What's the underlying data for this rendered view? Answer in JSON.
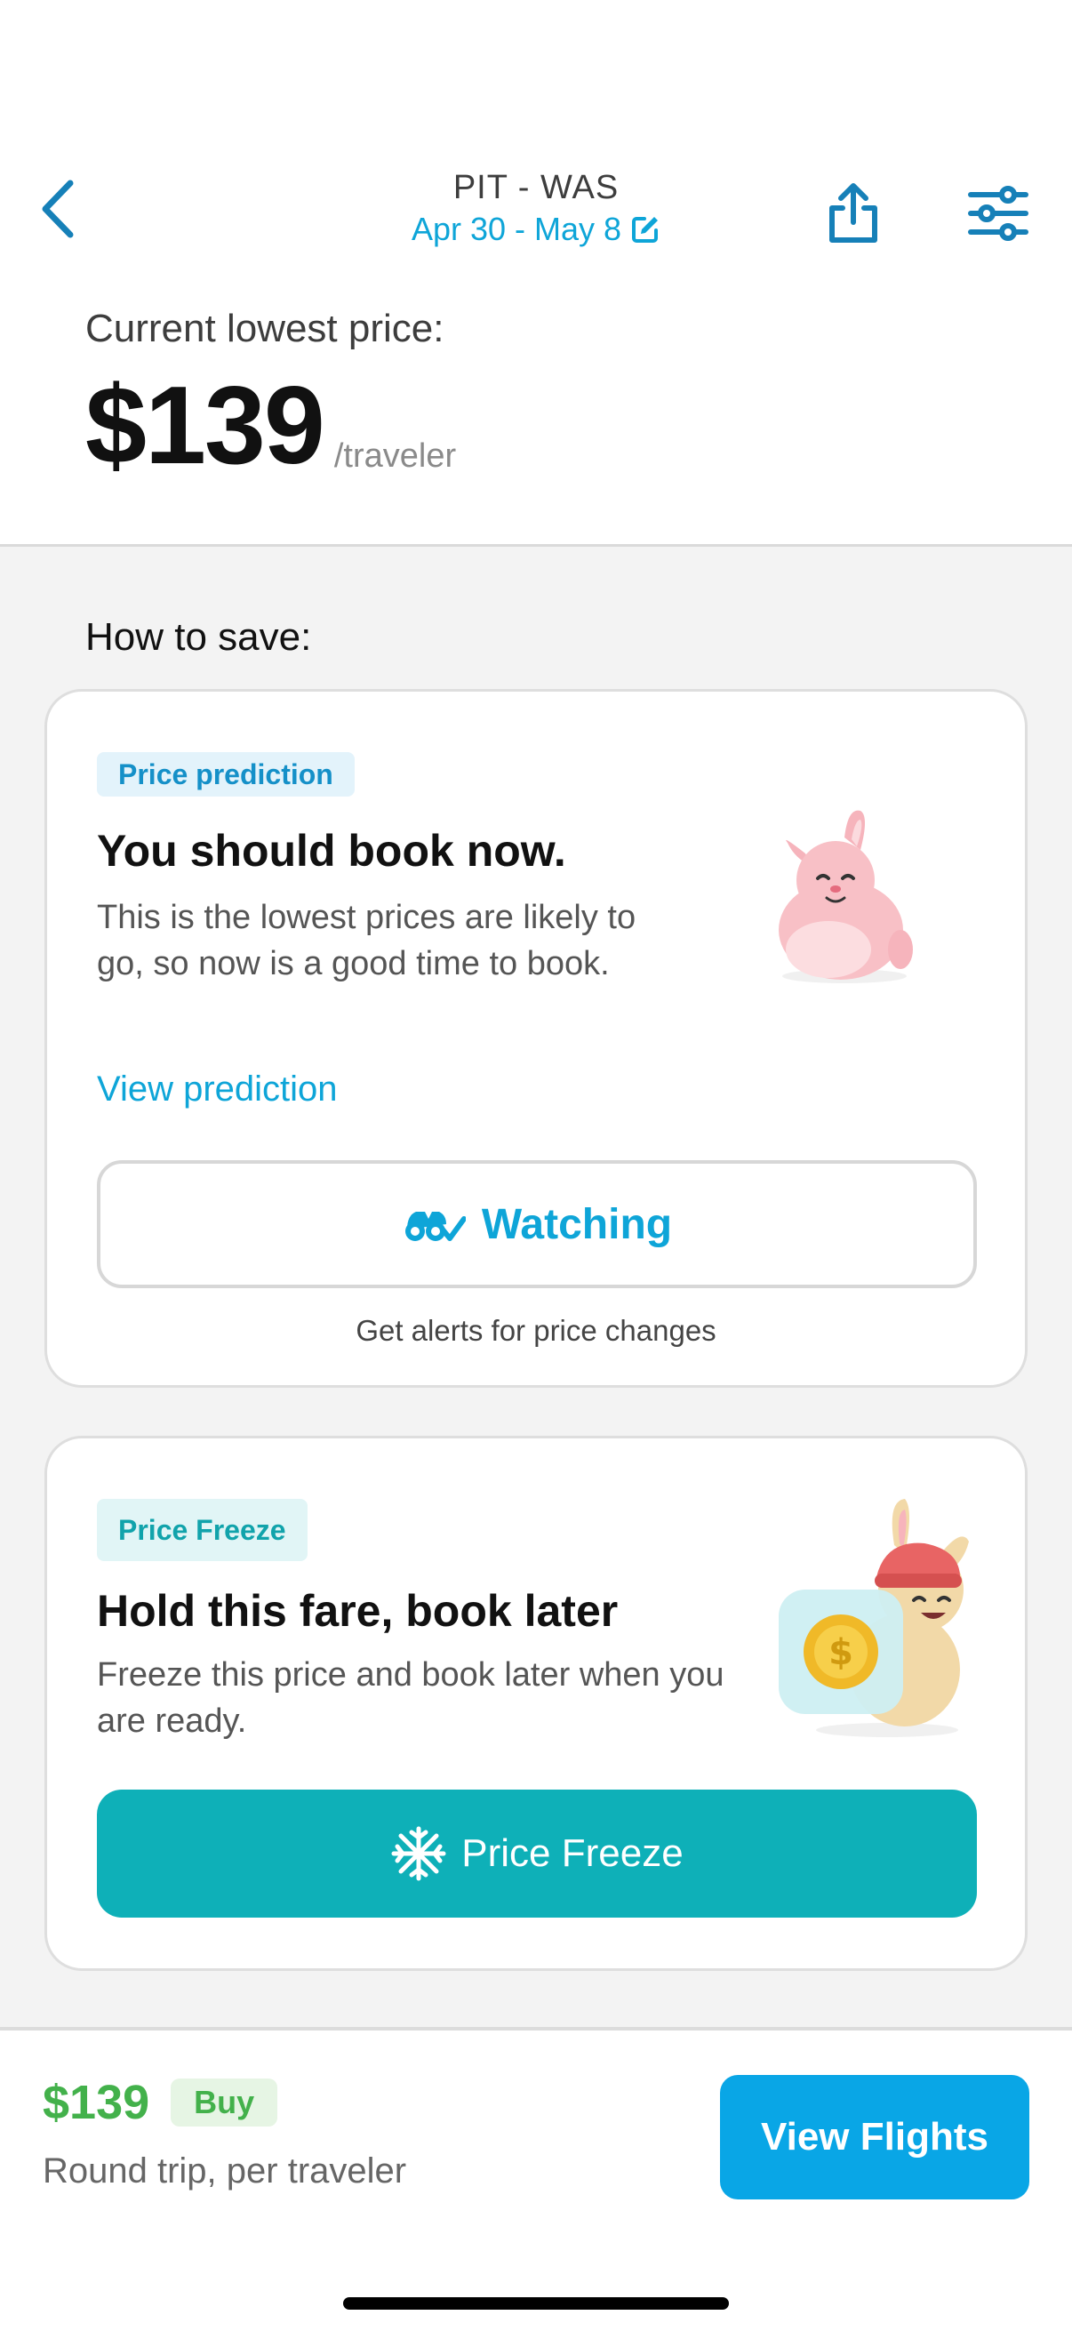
{
  "header": {
    "route": "PIT - WAS",
    "dates": "Apr 30 - May 8",
    "back_icon": "chevron-left-icon",
    "edit_icon": "pencil-edit-icon",
    "share_icon": "share-icon",
    "filter_icon": "sliders-icon"
  },
  "price": {
    "label": "Current lowest price:",
    "amount": "$139",
    "unit": "/traveler"
  },
  "save_section": {
    "label": "How to save:"
  },
  "prediction_card": {
    "badge": "Price prediction",
    "title": "You should book now.",
    "description": "This is the lowest prices are likely to go, so now is a good time to book.",
    "link": "View prediction",
    "watch_button": "Watching",
    "alerts_text": "Get alerts for price changes",
    "illustration": "pink-bunny-illustration"
  },
  "freeze_card": {
    "badge": "Price Freeze",
    "title": "Hold this fare, book later",
    "description": "Freeze this price and book later when you are ready.",
    "button": "Price Freeze",
    "illustration": "bunny-with-coin-illustration"
  },
  "bottom_bar": {
    "price": "$139",
    "badge": "Buy",
    "subtitle": "Round trip, per traveler",
    "button": "View Flights"
  },
  "colors": {
    "accent_blue": "#0ea5d8",
    "teal": "#0eb0b8",
    "green": "#43b14b"
  }
}
